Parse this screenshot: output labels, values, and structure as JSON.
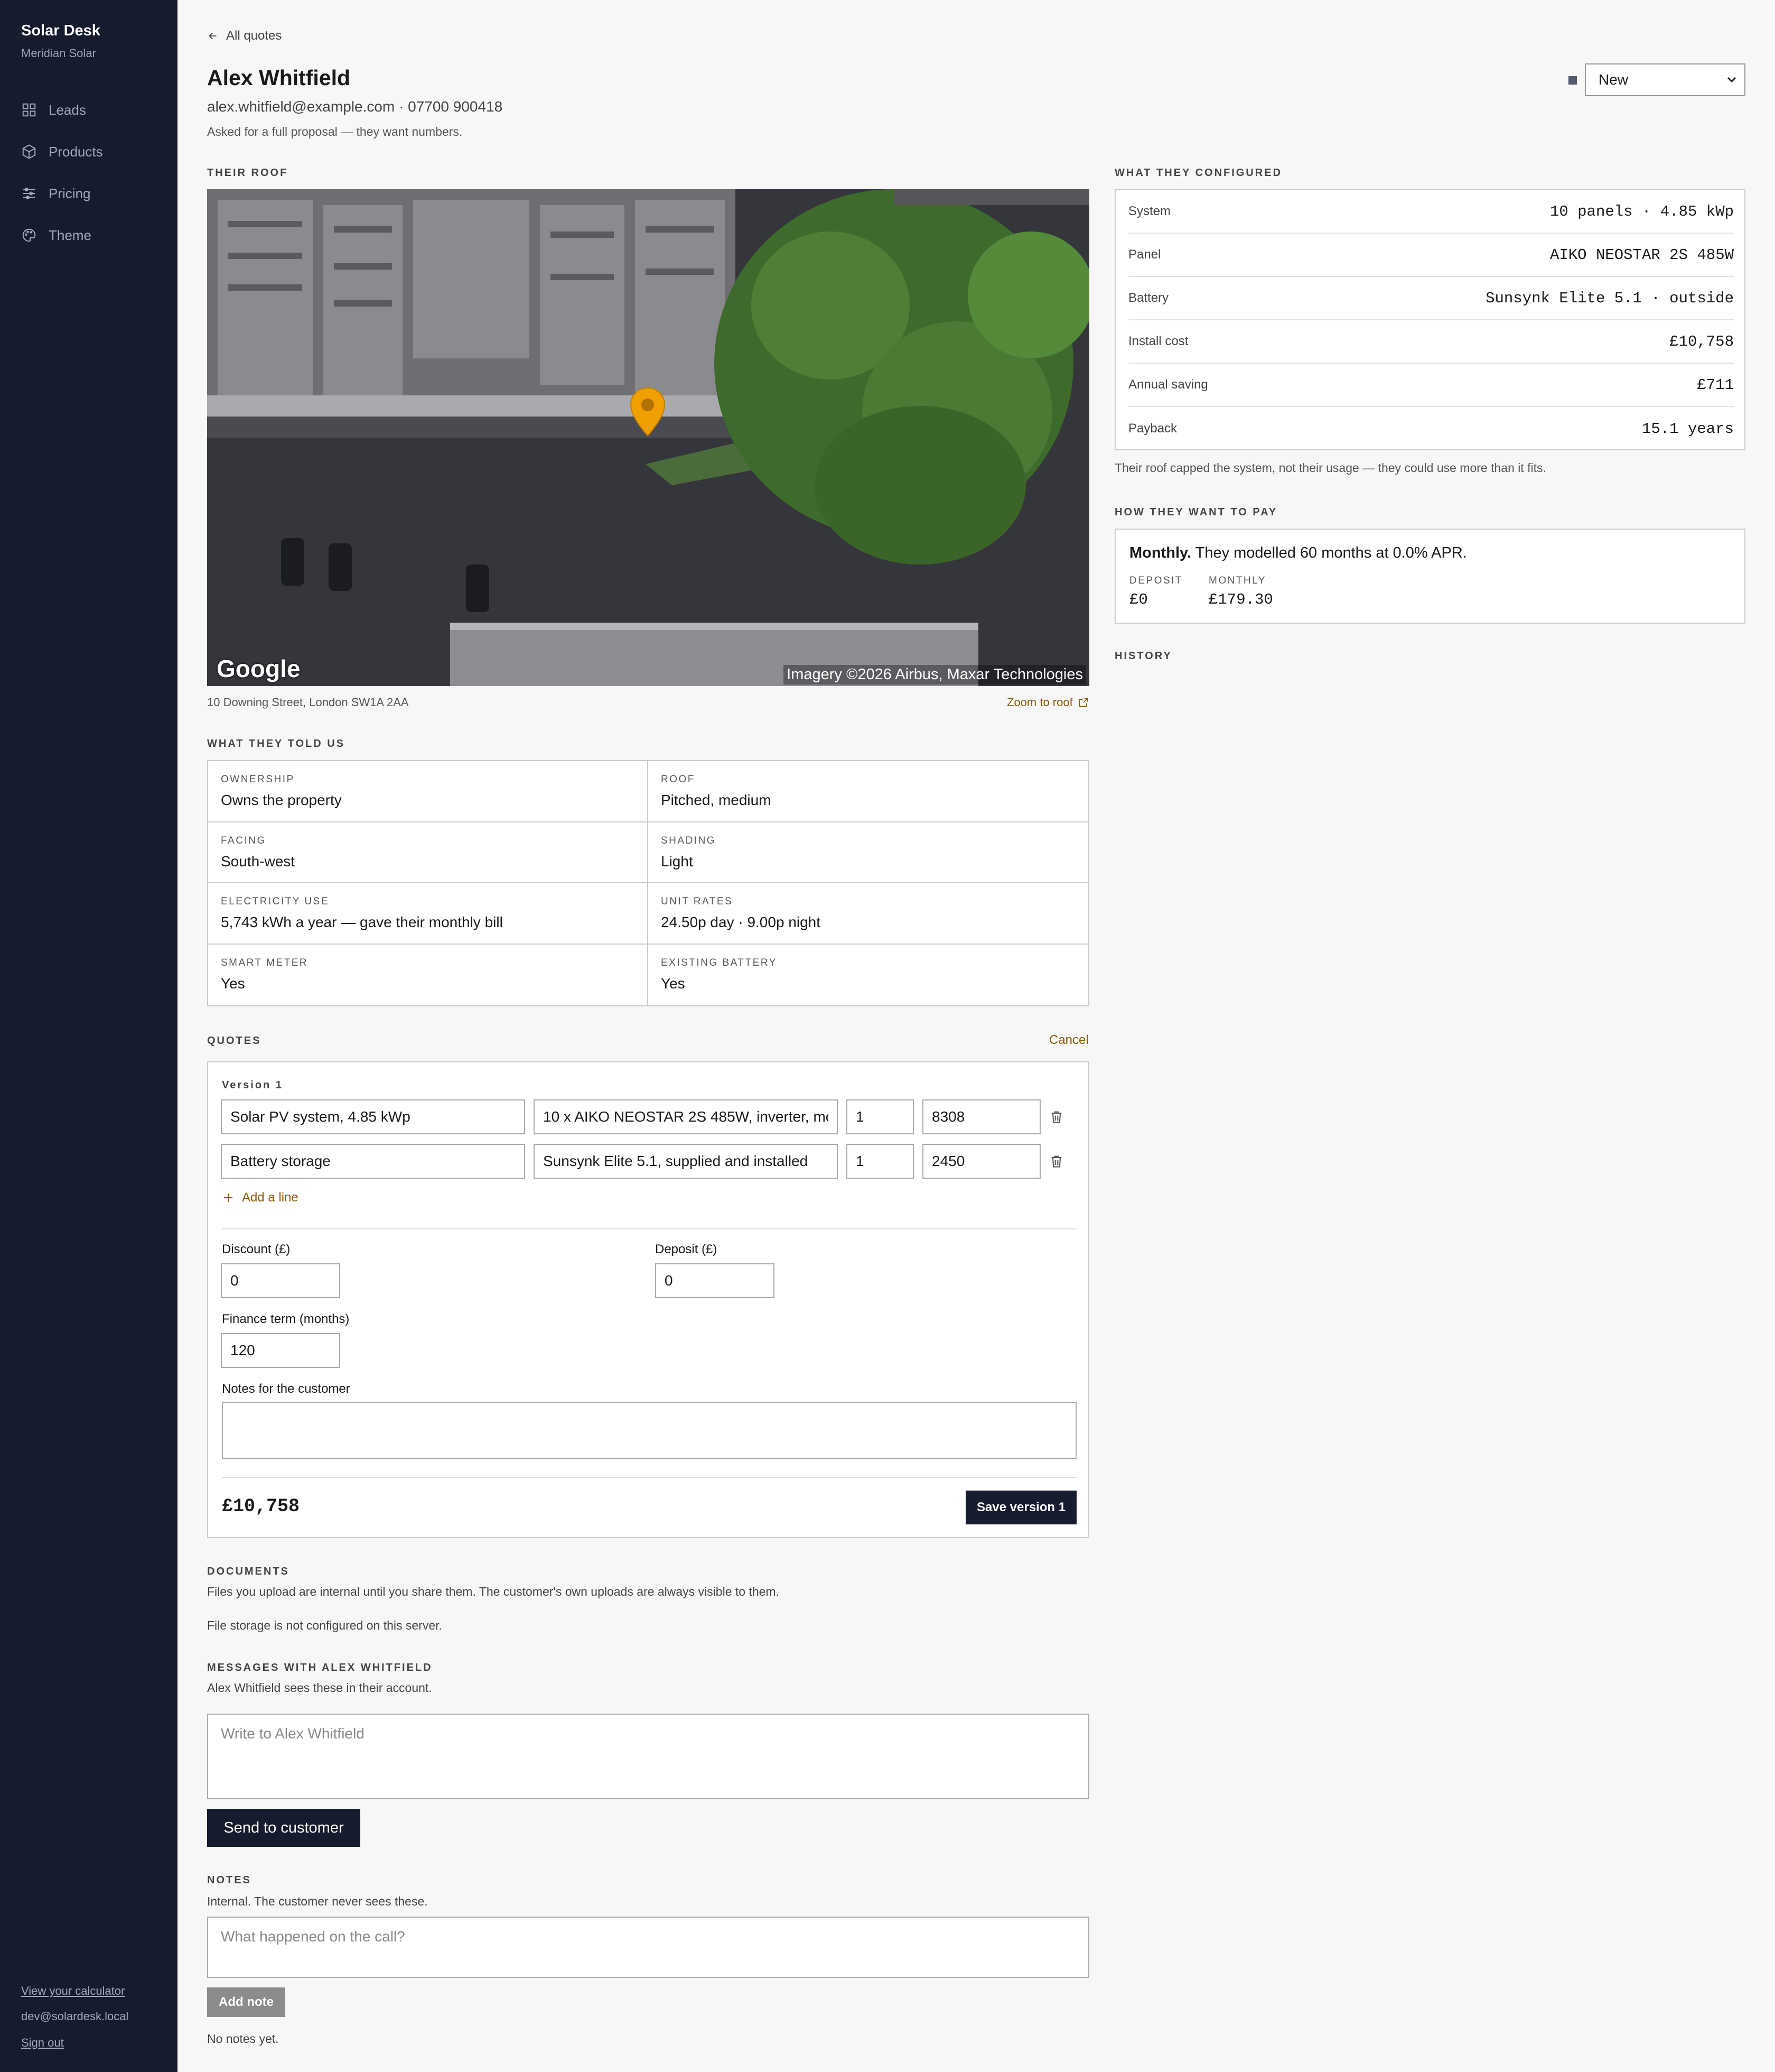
{
  "sidebar": {
    "brand": "Solar Desk",
    "company": "Meridian Solar",
    "items": [
      {
        "label": "Leads",
        "icon": "grid-icon"
      },
      {
        "label": "Products",
        "icon": "box-icon"
      },
      {
        "label": "Pricing",
        "icon": "sliders-icon"
      },
      {
        "label": "Theme",
        "icon": "palette-icon"
      }
    ],
    "calculator_link": "View your calculator",
    "user_email": "dev@solardesk.local",
    "sign_out": "Sign out"
  },
  "header": {
    "back_label": "All quotes",
    "name": "Alex Whitfield",
    "contact": "alex.whitfield@example.com · 07700 900418",
    "note": "Asked for a full proposal — they want numbers.",
    "status_value": "New"
  },
  "roof": {
    "heading": "Their roof",
    "address": "10 Downing Street, London SW1A 2AA",
    "zoom_label": "Zoom to roof",
    "map_logo": "Google",
    "map_attribution": "Imagery ©2026 Airbus, Maxar Technologies"
  },
  "told": {
    "heading": "What they told us",
    "facts": [
      {
        "k": "Ownership",
        "v": "Owns the property"
      },
      {
        "k": "Roof",
        "v": "Pitched, medium"
      },
      {
        "k": "Facing",
        "v": "South-west"
      },
      {
        "k": "Shading",
        "v": "Light"
      },
      {
        "k": "Electricity use",
        "v": "5,743 kWh a year — gave their monthly bill"
      },
      {
        "k": "Unit rates",
        "v": "24.50p day · 9.00p night"
      },
      {
        "k": "Smart meter",
        "v": "Yes"
      },
      {
        "k": "Existing battery",
        "v": "Yes"
      }
    ]
  },
  "quotes": {
    "heading": "Quotes",
    "cancel_label": "Cancel",
    "version_label": "Version 1",
    "lines": [
      {
        "name": "Solar PV system, 4.85 kWp",
        "desc": "10 x AIKO NEOSTAR 2S 485W, inverter, mo",
        "qty": "1",
        "price": "8308"
      },
      {
        "name": "Battery storage",
        "desc": "Sunsynk Elite 5.1, supplied and installed",
        "qty": "1",
        "price": "2450"
      }
    ],
    "add_line": "Add a line",
    "discount_label": "Discount (£)",
    "discount_value": "0",
    "deposit_label": "Deposit (£)",
    "deposit_value": "0",
    "term_label": "Finance term (months)",
    "term_value": "120",
    "notes_label": "Notes for the customer",
    "total": "£10,758",
    "save_label": "Save version 1"
  },
  "documents": {
    "heading": "Documents",
    "desc": "Files you upload are internal until you share them. The customer's own uploads are always visible to them.",
    "status": "File storage is not configured on this server."
  },
  "messages": {
    "heading": "Messages with Alex Whitfield",
    "desc": "Alex Whitfield sees these in their account.",
    "placeholder": "Write to Alex Whitfield",
    "send_label": "Send to customer"
  },
  "notes": {
    "heading": "Notes",
    "desc": "Internal. The customer never sees these.",
    "placeholder": "What happened on the call?",
    "add_label": "Add note",
    "empty": "No notes yet."
  },
  "configured": {
    "heading": "What they configured",
    "rows": [
      {
        "k": "System",
        "v": "10 panels · 4.85 kWp"
      },
      {
        "k": "Panel",
        "v": "AIKO NEOSTAR 2S 485W"
      },
      {
        "k": "Battery",
        "v": "Sunsynk Elite 5.1 · outside"
      },
      {
        "k": "Install cost",
        "v": "£10,758"
      },
      {
        "k": "Annual saving",
        "v": "£711"
      },
      {
        "k": "Payback",
        "v": "15.1 years"
      }
    ],
    "note": "Their roof capped the system, not their usage — they could use more than it fits."
  },
  "pay": {
    "heading": "How they want to pay",
    "mode": "Monthly.",
    "summary": "They modelled 60 months at 0.0% APR.",
    "deposit_label": "DEPOSIT",
    "deposit_value": "£0",
    "monthly_label": "MONTHLY",
    "monthly_value": "£179.30"
  },
  "history": {
    "heading": "History"
  },
  "colors": {
    "sidebar_bg": "#171b2e",
    "accent": "#8a5a00",
    "pin": "#f0a000"
  }
}
